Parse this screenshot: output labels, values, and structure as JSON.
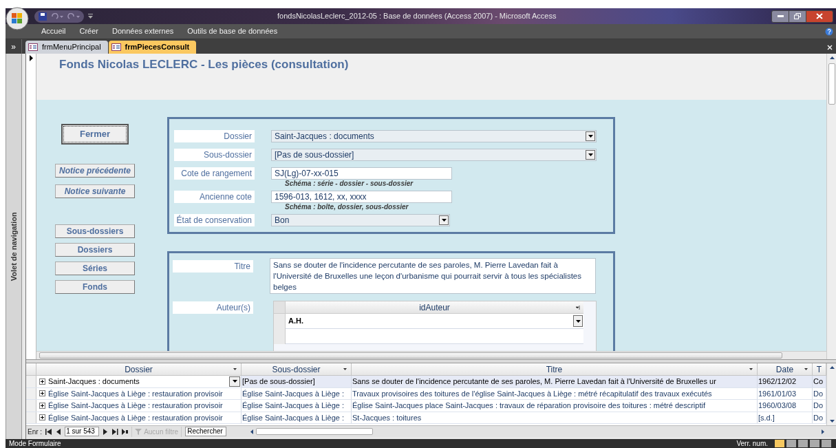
{
  "window": {
    "title": "fondsNicolasLeclerc_2012-05 : Base de données (Access 2007)  -  Microsoft Access"
  },
  "ribbon_tabs": [
    {
      "label": "Accueil"
    },
    {
      "label": "Créer"
    },
    {
      "label": "Données externes"
    },
    {
      "label": "Outils de base de données"
    }
  ],
  "document_tabs": [
    {
      "label": "frmMenuPrincipal",
      "selected": false
    },
    {
      "label": "frmPiecesConsult",
      "selected": true
    }
  ],
  "nav_pane": {
    "label": "Volet de navigation",
    "toggle": "»"
  },
  "form": {
    "title": "Fonds Nicolas LECLERC - Les pièces (consultation)",
    "buttons": [
      {
        "label": "Fermer",
        "kind": "close"
      },
      {
        "label": "Notice précédente",
        "kind": "nav"
      },
      {
        "label": "Notice suivante",
        "kind": "nav"
      },
      {
        "label": "Sous-dossiers",
        "kind": "list"
      },
      {
        "label": "Dossiers",
        "kind": "list"
      },
      {
        "label": "Séries",
        "kind": "list"
      },
      {
        "label": "Fonds",
        "kind": "list"
      }
    ],
    "fields": [
      {
        "label": "Dossier",
        "value": "Saint-Jacques : documents",
        "kind": "combo"
      },
      {
        "label": "Sous-dossier",
        "value": "[Pas de sous-dossier]",
        "kind": "combo"
      },
      {
        "label": "Cote de rangement",
        "value": "SJ(Lg)-07-xx-015",
        "kind": "text",
        "hint": "Schéma : série - dossier - sous-dossier"
      },
      {
        "label": "Ancienne cote",
        "value": "1596-013, 1612, xx, xxxx",
        "kind": "text",
        "hint": "Schéma : boîte, dossier, sous-dossier"
      },
      {
        "label": "État de conservation",
        "value": "Bon",
        "kind": "select"
      }
    ],
    "titre": {
      "label": "Titre",
      "value": "Sans se douter de l'incidence percutante de ses paroles, M. Pierre Lavedan fait à l'Université de Bruxelles une leçon d'urbanisme qui pourrait servir à tous les spécialistes belges"
    },
    "authors": {
      "label": "Auteur(s)",
      "column": "idAuteur",
      "rows": [
        "A.H."
      ]
    }
  },
  "datasheet": {
    "columns": [
      "Dossier",
      "Sous-dossier",
      "Titre",
      "Date",
      "T"
    ],
    "rows": [
      {
        "selected": true,
        "cells": [
          "Saint-Jacques : documents",
          "[Pas de sous-dossier]",
          "Sans se douter de l'incidence percutante de ses paroles, M. Pierre Lavedan fait à l'Université de Bruxelles ur",
          "1962/12/02",
          "Co"
        ]
      },
      {
        "selected": false,
        "cells": [
          "Église Saint-Jacques à Liège : restauration provisoir",
          "Église Saint-Jacques à Liège :",
          "Travaux provisoires des toitures de l'église Saint-Jacques à Liège : métré récapitulatif des travaux exécutés",
          "1961/01/03",
          "Do"
        ]
      },
      {
        "selected": false,
        "cells": [
          "Église Saint-Jacques à Liège : restauration provisoir",
          "Église Saint-Jacques à Liège :",
          "Église Saint-Jacques place Saint-Jacques : travaux de réparation provisoire des toitures : métré descriptif",
          "1960/03/08",
          "Do"
        ]
      },
      {
        "selected": false,
        "cells": [
          "Église Saint-Jacques à Liège : restauration provisoir",
          "Église Saint-Jacques à Liège :",
          "St-Jacques : toitures",
          "[s.d.]",
          "Do"
        ]
      }
    ]
  },
  "record_nav": {
    "label": "Enr :",
    "position": "1 sur 543",
    "filter": "Aucun filtre",
    "search": "Rechercher"
  },
  "status_bar": {
    "mode": "Mode Formulaire",
    "indicator": "Verr. num."
  }
}
